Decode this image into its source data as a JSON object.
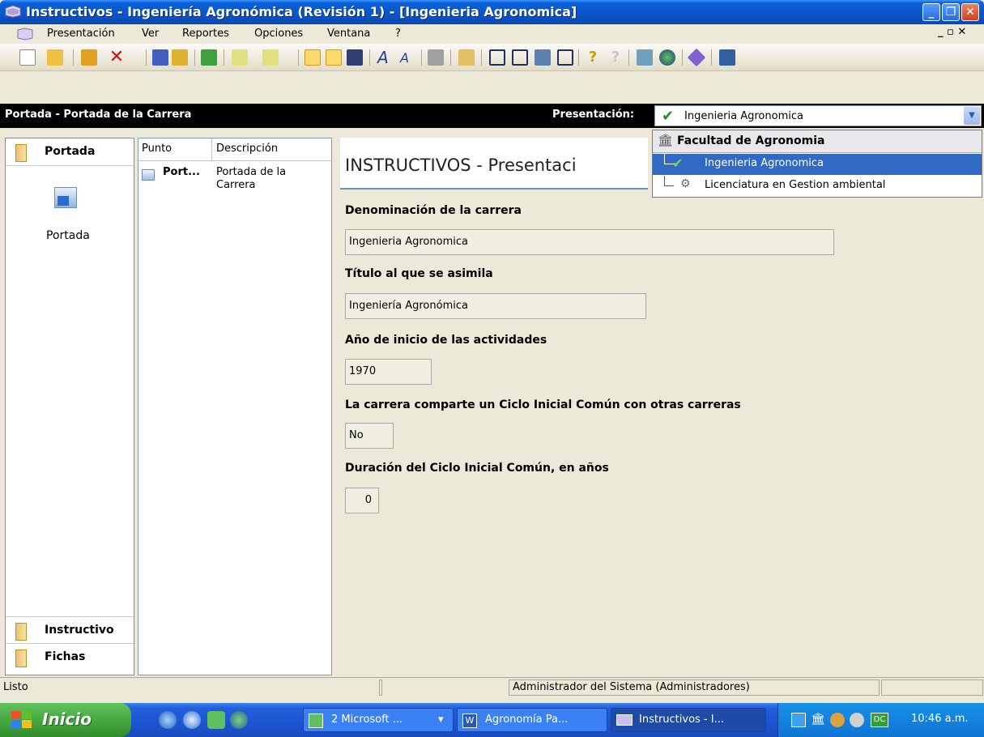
{
  "window": {
    "title": "Instructivos - Ingeniería Agronómica (Revisión 1) - [Ingenieria Agronomica]",
    "caption_buttons": [
      "minimize",
      "restore",
      "close"
    ]
  },
  "menu": {
    "items": [
      "Presentación",
      "Ver",
      "Reportes",
      "Opciones",
      "Ventana",
      "?"
    ],
    "mdi_controls": "_ ▫ ✕"
  },
  "caption_bar": {
    "title": "Portada - Portada de la Carrera",
    "presentacion_label": "Presentación:",
    "presentacion_value": "Ingenieria Agronomica"
  },
  "dropdown": {
    "group": "Facultad de Agronomia",
    "options": [
      "Ingenieria Agronomica",
      "Licenciatura en Gestion ambiental"
    ],
    "selected_index": 0
  },
  "left_bar": {
    "sections": [
      "Portada",
      "Instructivo",
      "Fichas"
    ],
    "active_item_label": "Portada"
  },
  "list": {
    "columns": [
      "Punto",
      "Descripción"
    ],
    "rows": [
      {
        "punto": "Port...",
        "descripcion_1": "Portada de la",
        "descripcion_2": "Carrera"
      }
    ]
  },
  "content": {
    "heading": "INSTRUCTIVOS - Presentaci",
    "fields": [
      {
        "label": "Denominación de la carrera",
        "value": "Ingenieria Agronomica"
      },
      {
        "label": "Título al que se asimila",
        "value": "Ingeniería Agronómica"
      },
      {
        "label": "Año de inicio de las actividades",
        "value": "1970"
      },
      {
        "label": "La carrera comparte un Ciclo Inicial Común con otras carreras",
        "value": "No"
      },
      {
        "label": "Duración del Ciclo Inicial Común, en años",
        "value": "0"
      }
    ]
  },
  "status": {
    "left": "Listo",
    "user": "Administrador del Sistema (Administradores)"
  },
  "taskbar": {
    "start": "Inicio",
    "buttons": [
      "2 Microsoft ...",
      "Agronomía Pa...",
      "Instructivos - I..."
    ],
    "clock": "10:46 a.m."
  },
  "colors": {
    "titlebar": "#0a5fd8",
    "selection": "#316ac5",
    "caption": "#000000",
    "taskbar": "#245edb",
    "start": "#3c9b36"
  }
}
